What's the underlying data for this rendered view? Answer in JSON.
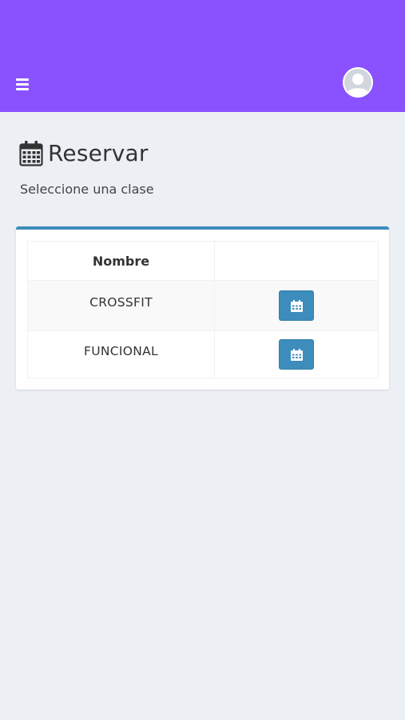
{
  "colors": {
    "topbar": "#8a52ff",
    "background": "#ecf0f5",
    "accent": "#3c8dbc",
    "button": "#3c8dbc"
  },
  "header": {
    "menu_icon": "hamburger-icon",
    "avatar_icon": "user-avatar-icon"
  },
  "page": {
    "title_icon": "calendar-icon",
    "title": "Reservar",
    "subtitle": "Seleccione una clase"
  },
  "table": {
    "columns": [
      "Nombre",
      ""
    ],
    "rows": [
      {
        "name": "CROSSFIT",
        "action_icon": "calendar-icon"
      },
      {
        "name": "FUNCIONAL",
        "action_icon": "calendar-icon"
      }
    ]
  }
}
